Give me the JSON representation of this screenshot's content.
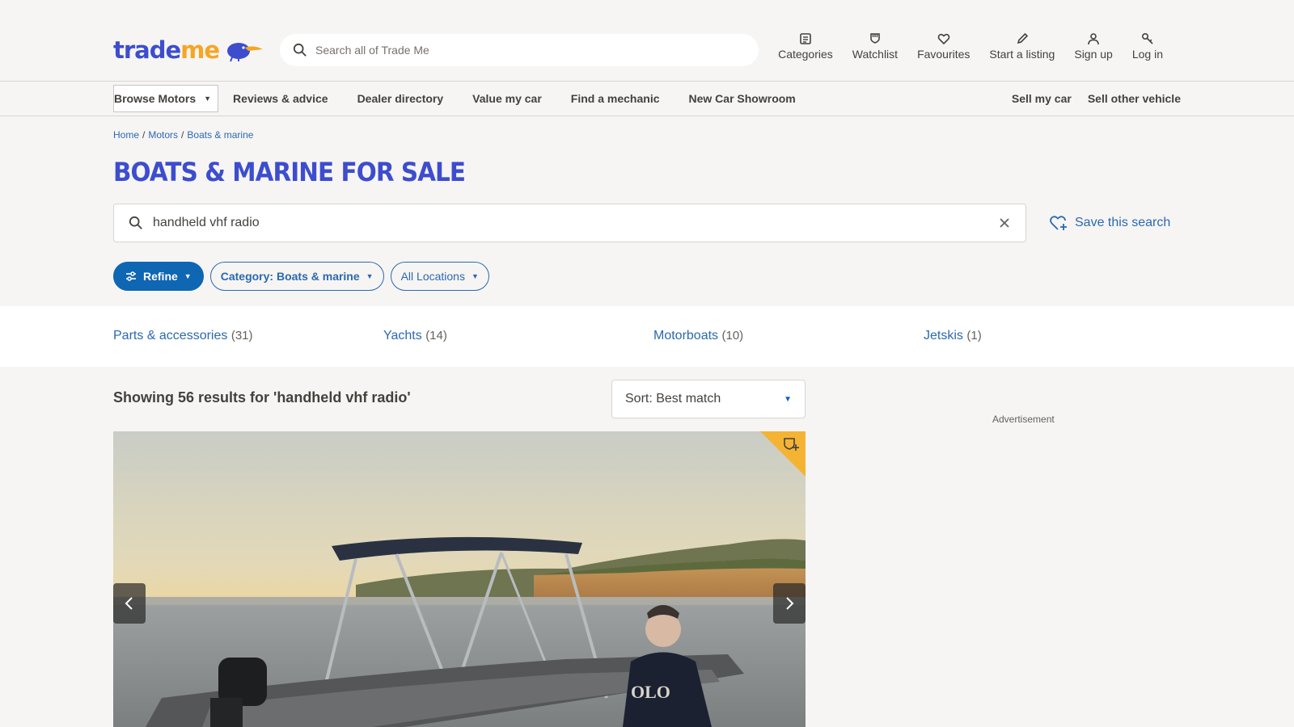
{
  "header": {
    "logo": {
      "word1": "trade",
      "word2": "me"
    },
    "search_placeholder": "Search all of Trade Me",
    "actions": [
      {
        "label": "Categories",
        "icon": "categories-icon"
      },
      {
        "label": "Watchlist",
        "icon": "watchlist-icon"
      },
      {
        "label": "Favourites",
        "icon": "heart-icon"
      },
      {
        "label": "Start a listing",
        "icon": "pencil-icon"
      },
      {
        "label": "Sign up",
        "icon": "user-icon"
      },
      {
        "label": "Log in",
        "icon": "key-icon"
      }
    ]
  },
  "motors_nav": {
    "browse": "Browse Motors",
    "items": [
      "Reviews & advice",
      "Dealer directory",
      "Value my car",
      "Find a mechanic",
      "New Car Showroom"
    ],
    "right_items": [
      "Sell my car",
      "Sell other vehicle"
    ]
  },
  "breadcrumb": [
    "Home",
    "Motors",
    "Boats & marine"
  ],
  "page_title": "Boats & marine for sale",
  "search": {
    "value": "handheld vhf radio",
    "save_label": "Save this search"
  },
  "filters": {
    "refine": "Refine",
    "category": "Category: Boats & marine",
    "location": "All Locations"
  },
  "categories": [
    {
      "label": "Parts & accessories",
      "count": "(31)"
    },
    {
      "label": "Yachts",
      "count": "(14)"
    },
    {
      "label": "Motorboats",
      "count": "(10)"
    },
    {
      "label": "Jetskis",
      "count": "(1)"
    }
  ],
  "results": {
    "summary": "Showing 56 results for 'handheld vhf radio'",
    "sort": "Sort: Best match"
  },
  "advertisement_label": "Advertisement",
  "colors": {
    "brand_blue": "#3d4dce",
    "brand_orange": "#f5a623",
    "link_blue": "#2b69b0",
    "button_blue": "#0f66b3"
  }
}
